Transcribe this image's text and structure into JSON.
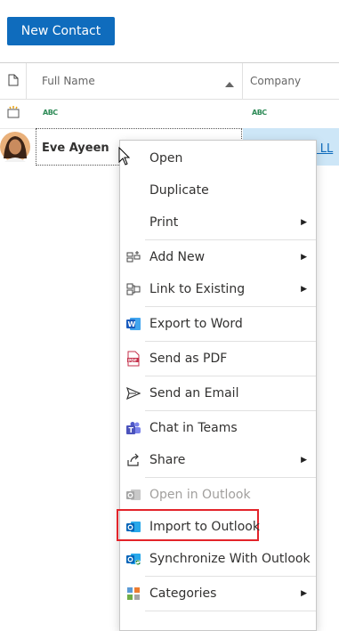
{
  "toolbar": {
    "new_contact_label": "New Contact"
  },
  "grid": {
    "columns": {
      "full_name": "Full Name",
      "company": "Company"
    },
    "filter_placeholder": "ABC",
    "rows": [
      {
        "full_name": "Eve Ayeen",
        "company": "m LL"
      }
    ]
  },
  "context_menu": {
    "items": [
      {
        "label": "Open",
        "icon": "none"
      },
      {
        "label": "Duplicate",
        "icon": "none"
      },
      {
        "label": "Print",
        "icon": "none",
        "submenu": true
      },
      {
        "label": "Add New",
        "icon": "add-new-icon",
        "submenu": true
      },
      {
        "label": "Link to Existing",
        "icon": "link-icon",
        "submenu": true
      },
      {
        "label": "Export to Word",
        "icon": "word-icon"
      },
      {
        "label": "Send as PDF",
        "icon": "pdf-icon"
      },
      {
        "label": "Send an Email",
        "icon": "send-icon"
      },
      {
        "label": "Chat in Teams",
        "icon": "teams-icon"
      },
      {
        "label": "Share",
        "icon": "share-icon",
        "submenu": true
      },
      {
        "label": "Open in Outlook",
        "icon": "outlook-icon",
        "disabled": true
      },
      {
        "label": "Import to Outlook",
        "icon": "outlook-icon",
        "highlighted": true
      },
      {
        "label": "Synchronize With Outlook",
        "icon": "outlook-sync-icon"
      },
      {
        "label": "Categories",
        "icon": "categories-icon",
        "submenu": true
      }
    ]
  },
  "colors": {
    "accent": "#0f6cbd",
    "highlight_border": "#e3232a",
    "selected_row": "#cde6f7"
  }
}
